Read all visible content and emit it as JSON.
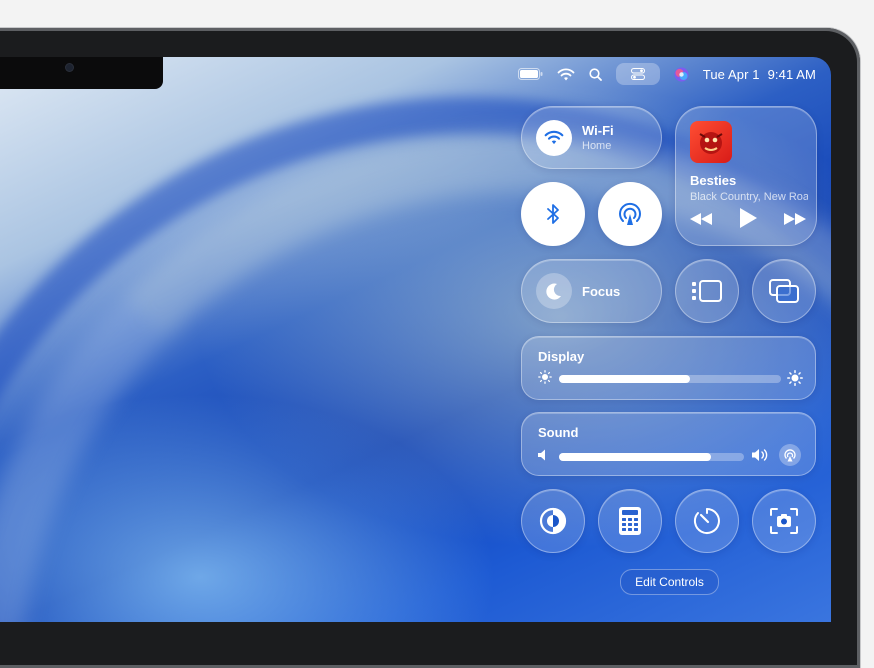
{
  "menubar": {
    "date": "Tue Apr 1",
    "time": "9:41 AM",
    "icons": [
      "battery-icon",
      "wifi-icon",
      "search-icon",
      "control-center-icon",
      "siri-icon"
    ]
  },
  "control_center": {
    "wifi": {
      "title": "Wi-Fi",
      "network": "Home"
    },
    "now_playing": {
      "song": "Besties",
      "artist": "Black Country, New Road"
    },
    "focus": {
      "label": "Focus"
    },
    "display": {
      "label": "Display",
      "brightness_fraction": 0.59
    },
    "sound": {
      "label": "Sound",
      "volume_fraction": 0.82
    },
    "edit_controls_label": "Edit Controls"
  },
  "colors": {
    "accent_blue": "#1f6fe5",
    "tile_white": "#ffffff"
  }
}
